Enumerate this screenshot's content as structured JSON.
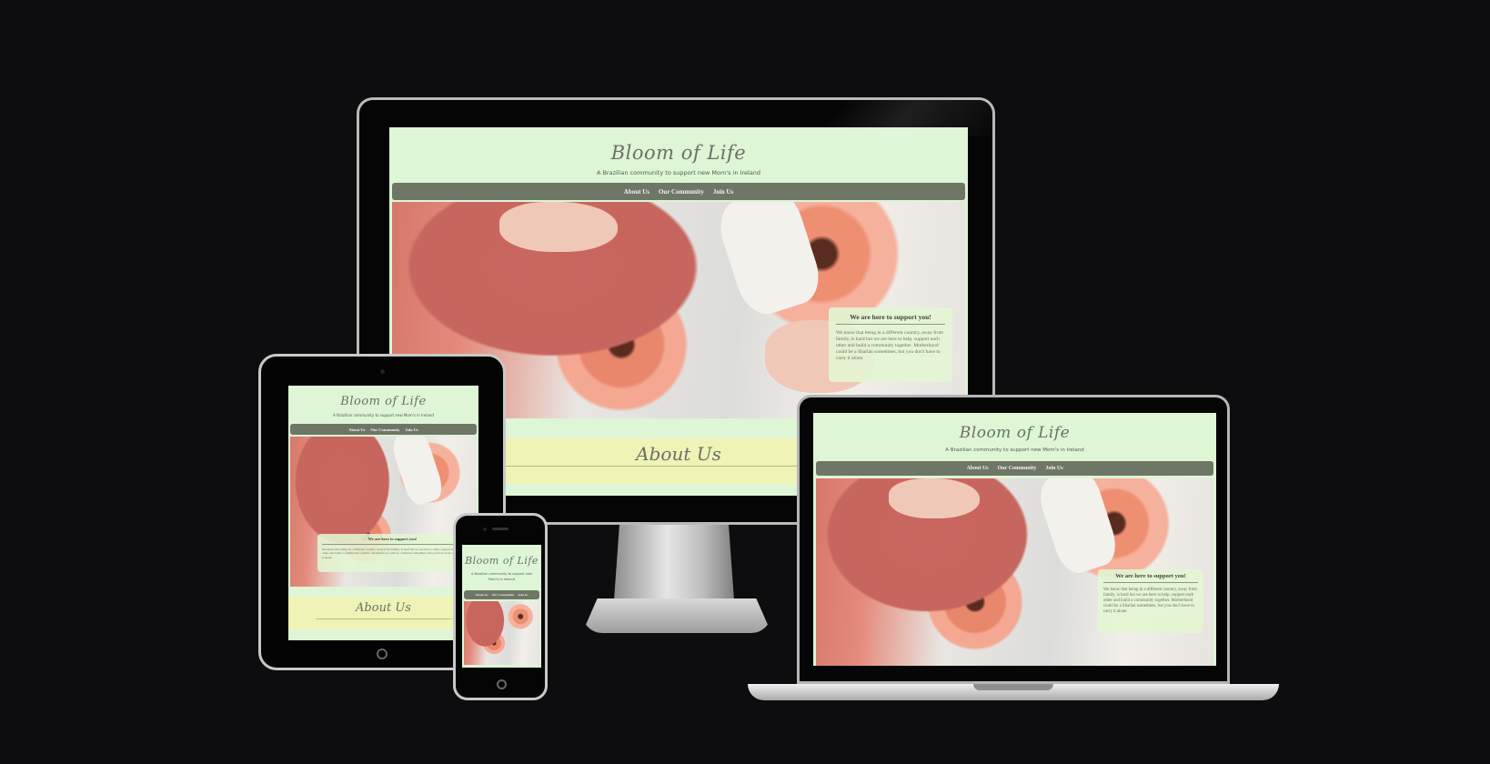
{
  "site": {
    "title": "Bloom of Life",
    "tagline": "A Brazilian community to support new Mom's in Ireland",
    "nav": [
      "About Us",
      "Our Community",
      "Join Us"
    ],
    "callout": {
      "title": "We are here to support you!",
      "text": "We know that being in a different country, away from family, is hard but we are here to help, support each other and build a community together. Motherhood could be a Sbarlan sometimes, but you don't have to carry it alone."
    },
    "about_title": "About Us"
  },
  "colors": {
    "background": "#0d0c0e",
    "header": "#def5d6",
    "nav": "#6e7665",
    "about_band": "#eff3b5",
    "callout": "#e2f6d3"
  },
  "devices": [
    "desktop-monitor",
    "tablet",
    "phone",
    "laptop"
  ]
}
